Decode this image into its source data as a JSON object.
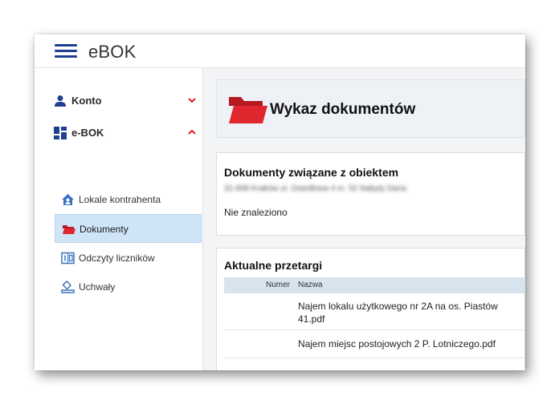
{
  "app": {
    "title": "eBOK"
  },
  "sidebar": {
    "groups": [
      {
        "label": "Konto"
      },
      {
        "label": "e-BOK"
      }
    ],
    "items": [
      {
        "label": "Lokale kontrahenta"
      },
      {
        "label": "Dokumenty"
      },
      {
        "label": "Odczyty liczników"
      },
      {
        "label": "Uchwały"
      }
    ]
  },
  "main": {
    "page_title": "Wykaz dokumentów",
    "objects_card": {
      "title": "Dokumenty związane z obiektem",
      "address_blurred": "31-608 Kraków ul. Osiedlowa 4 m. 52 Nabyty Daria",
      "empty_message": "Nie znaleziono"
    },
    "tenders_card": {
      "title": "Aktualne przetargi",
      "columns": {
        "number": "Numer",
        "name": "Nazwa"
      },
      "rows": [
        {
          "number": "",
          "name": "Najem lokalu użytkowego nr 2A na os. Piastów 41.pdf"
        },
        {
          "number": "",
          "name": "Najem miejsc postojowych 2 P. Lotniczego.pdf"
        }
      ]
    }
  },
  "colors": {
    "brand_blue": "#1f3f8f",
    "accent_red": "#d9222a",
    "active_bg": "#cfe5f7",
    "table_header_bg": "#d7e4ee"
  }
}
